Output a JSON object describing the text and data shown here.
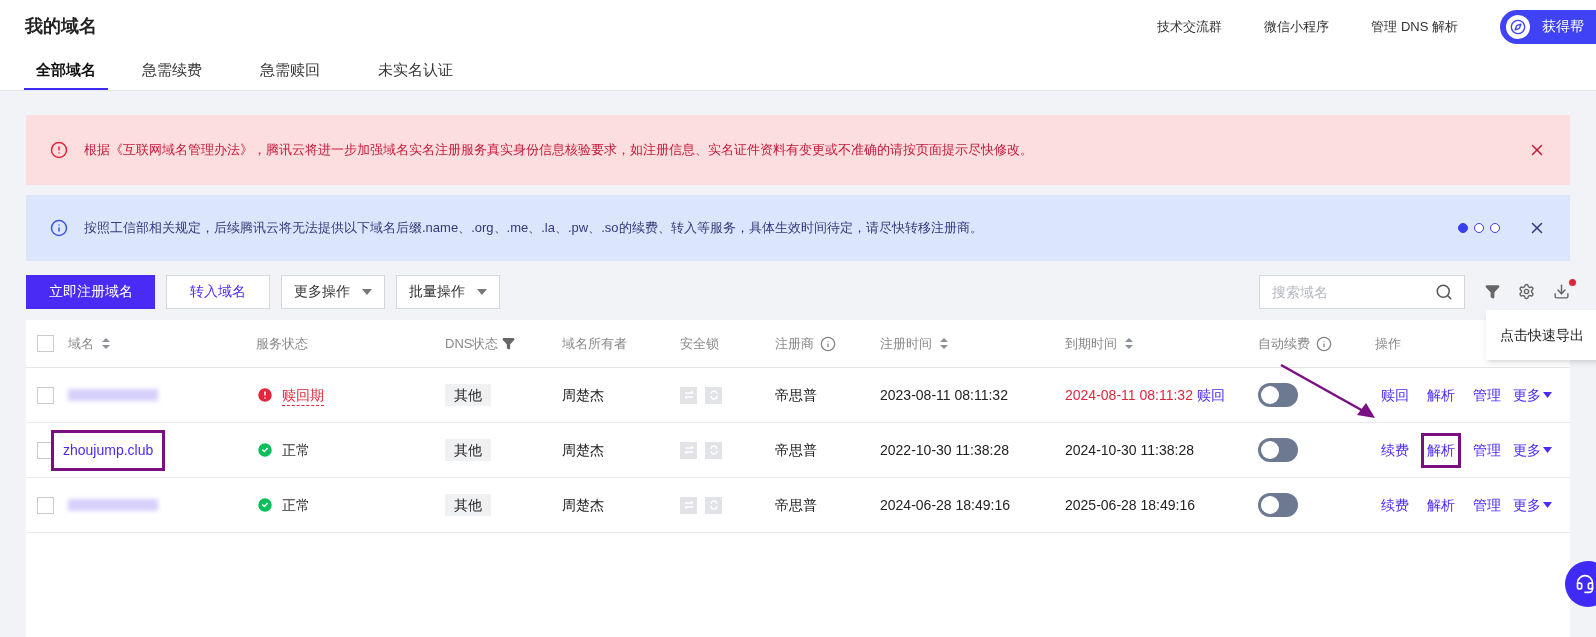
{
  "header": {
    "title": "我的域名",
    "links": [
      "技术交流群",
      "微信小程序",
      "管理 DNS 解析"
    ],
    "help_button": "获得帮"
  },
  "tabs": [
    {
      "label": "全部域名",
      "selected": true
    },
    {
      "label": "急需续费",
      "selected": false
    },
    {
      "label": "急需赎回",
      "selected": false
    },
    {
      "label": "未实名认证",
      "selected": false
    }
  ],
  "alerts": [
    {
      "kind": "error",
      "text": "根据《互联网域名管理办法》，腾讯云将进一步加强域名实名注册服务真实身份信息核验要求，如注册信息、实名证件资料有变更或不准确的请按页面提示尽快修改。"
    },
    {
      "kind": "info",
      "text": "按照工信部相关规定，后续腾讯云将无法提供以下域名后缀.name、.org、.me、.la、.pw、.so的续费、转入等服务，具体生效时间待定，请尽快转移注册商。",
      "pages": [
        {
          "selected": true
        },
        {
          "selected": false
        },
        {
          "selected": false
        }
      ]
    }
  ],
  "toolbar": {
    "primary_button": "立即注册域名",
    "secondary_button": "转入域名",
    "dropdowns": [
      "更多操作",
      "批量操作"
    ],
    "search": {
      "placeholder": "搜索域名"
    },
    "export_tooltip": "点击快速导出",
    "export_badge": true
  },
  "table": {
    "all_checked": false,
    "columns": [
      {
        "label": "域名",
        "kind": "sort"
      },
      {
        "label": "服务状态",
        "kind": "plain"
      },
      {
        "label": "DNS状态",
        "kind": "filter"
      },
      {
        "label": "域名所有者",
        "kind": "plain"
      },
      {
        "label": "安全锁",
        "kind": "plain"
      },
      {
        "label": "注册商",
        "kind": "info"
      },
      {
        "label": "注册时间",
        "kind": "sort"
      },
      {
        "label": "到期时间",
        "kind": "sort"
      },
      {
        "label": "自动续费",
        "kind": "info"
      },
      {
        "label": "操作",
        "kind": "plain"
      }
    ],
    "rows": [
      {
        "checked": false,
        "domain_blurred": true,
        "status": {
          "kind": "redemption",
          "label": "赎回期"
        },
        "dns": "其他",
        "owner": "周楚杰",
        "registrar": "帝思普",
        "registered": "2023-08-11 08:11:32",
        "expires": "2024-08-11 08:11:32",
        "expired": true,
        "expiry_link": "赎回",
        "auto_renew": false,
        "actions": [
          {
            "label": "赎回",
            "highlighted": false
          },
          {
            "label": "解析",
            "highlighted": false
          },
          {
            "label": "管理",
            "highlighted": false
          }
        ],
        "more": "更多"
      },
      {
        "checked": false,
        "domain": "zhoujump.club",
        "domain_highlighted": true,
        "status": {
          "kind": "normal",
          "label": "正常"
        },
        "dns": "其他",
        "owner": "周楚杰",
        "registrar": "帝思普",
        "registered": "2022-10-30 11:38:28",
        "expires": "2024-10-30 11:38:28",
        "expired": false,
        "auto_renew": false,
        "actions": [
          {
            "label": "续费",
            "highlighted": false
          },
          {
            "label": "解析",
            "highlighted": true
          },
          {
            "label": "管理",
            "highlighted": false
          }
        ],
        "more": "更多"
      },
      {
        "checked": false,
        "domain_blurred": true,
        "status": {
          "kind": "normal",
          "label": "正常"
        },
        "dns": "其他",
        "owner": "周楚杰",
        "registrar": "帝思普",
        "registered": "2024-06-28 18:49:16",
        "expires": "2025-06-28 18:49:16",
        "expired": false,
        "auto_renew": false,
        "actions": [
          {
            "label": "续费",
            "highlighted": false
          },
          {
            "label": "解析",
            "highlighted": false
          },
          {
            "label": "管理",
            "highlighted": false
          }
        ],
        "more": "更多"
      }
    ]
  }
}
